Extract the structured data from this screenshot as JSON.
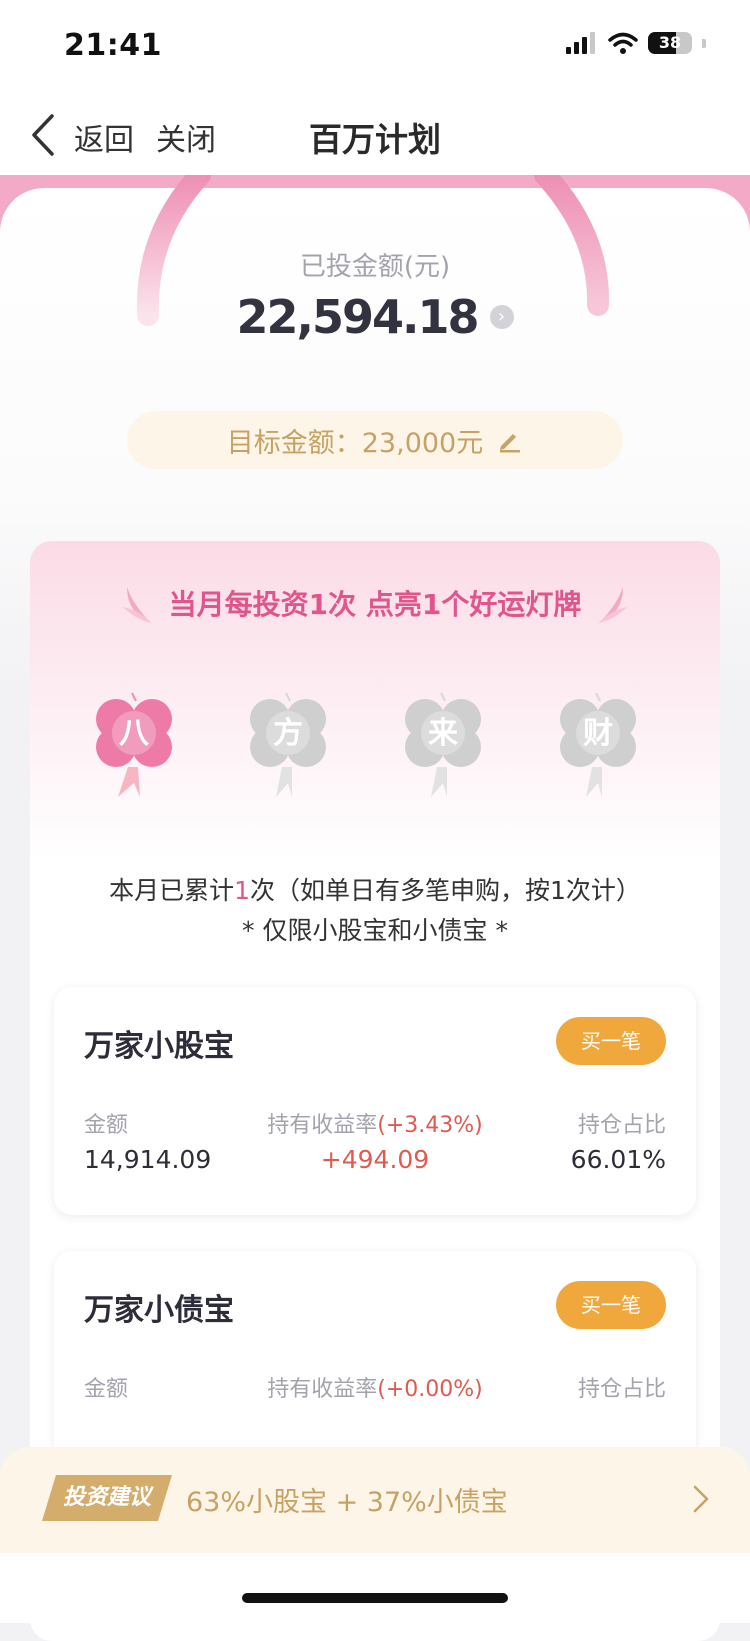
{
  "status_bar": {
    "time": "21:41",
    "battery": "38"
  },
  "nav": {
    "back_label": "返回",
    "close_label": "关闭",
    "title": "百万计划"
  },
  "summary": {
    "invested_label": "已投金额(元)",
    "invested_amount": "22,594.18",
    "target_text": "目标金额：23,000元"
  },
  "lucky": {
    "title": "当月每投资1次 点亮1个好运灯牌",
    "clovers": [
      {
        "char": "八",
        "lit": true
      },
      {
        "char": "方",
        "lit": false
      },
      {
        "char": "来",
        "lit": false
      },
      {
        "char": "财",
        "lit": false
      }
    ],
    "count_prefix": "本月已累计",
    "count_value": "1",
    "count_suffix": "次（如单日有多笔申购，按1次计）",
    "limit_text": "* 仅限小股宝和小债宝 *"
  },
  "funds": [
    {
      "name": "万家小股宝",
      "buy_label": "买一笔",
      "amount_label": "金额",
      "amount_value": "14,914.09",
      "return_label": "持有收益率",
      "return_rate": "(+3.43%)",
      "return_value": "+494.09",
      "ratio_label": "持仓占比",
      "ratio_value": "66.01%"
    },
    {
      "name": "万家小债宝",
      "buy_label": "买一笔",
      "amount_label": "金额",
      "return_label": "持有收益率",
      "return_rate": "(+0.00%)",
      "ratio_label": "持仓占比"
    }
  ],
  "advice": {
    "badge": "投资建议",
    "text": "63%小股宝 + 37%小债宝"
  },
  "colors": {
    "pink_accent": "#e0568c",
    "gold_text": "#c6a265",
    "buy_button": "#f0a83c",
    "positive_red": "#e05a50"
  }
}
